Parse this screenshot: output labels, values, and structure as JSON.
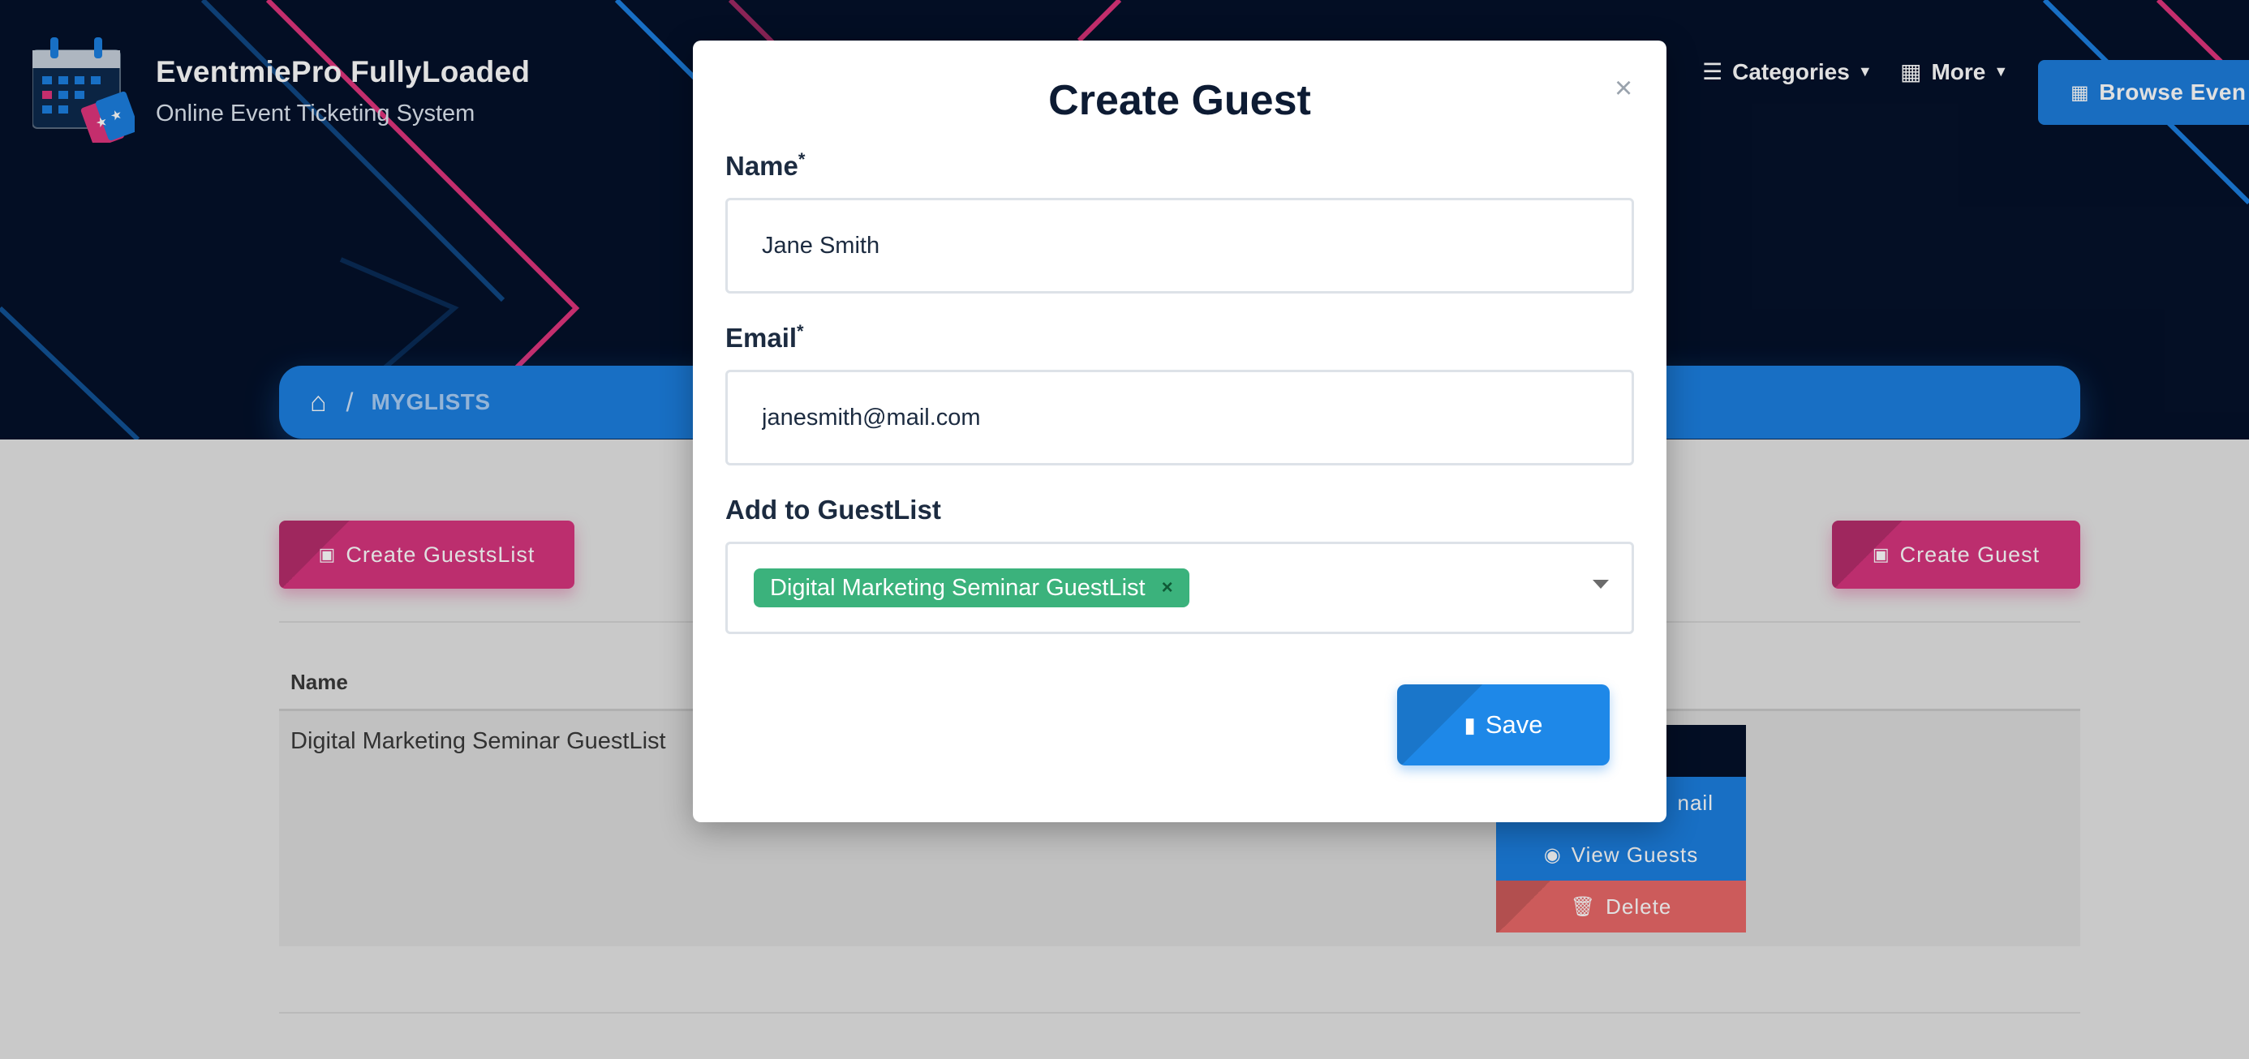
{
  "brand": {
    "title": "EventmiePro FullyLoaded",
    "subtitle": "Online Event Ticketing System"
  },
  "nav": {
    "categories": "Categories",
    "more": "More",
    "browse": "Browse Even"
  },
  "breadcrumb": {
    "current": "MYGLISTS"
  },
  "actions": {
    "create_guestslist": "Create GuestsList",
    "create_guest": "Create Guest"
  },
  "table": {
    "headers": [
      "Name"
    ],
    "rows": [
      {
        "name": "Digital Marketing Seminar GuestList"
      }
    ]
  },
  "row_menu": {
    "email": "nail",
    "view_guests": "View Guests",
    "delete": "Delete"
  },
  "modal": {
    "title": "Create Guest",
    "close": "×",
    "name_label": "Name",
    "name_value": "Jane Smith",
    "email_label": "Email",
    "email_value": "janesmith@mail.com",
    "guestlist_label": "Add to GuestList",
    "selected_guestlist": "Digital Marketing Seminar GuestList",
    "tag_remove": "×",
    "required_mark": "*",
    "save": "Save"
  },
  "colors": {
    "header_bg": "#04112a",
    "primary": "#1c7fe0",
    "pink": "#d6357e",
    "green_tag": "#3bb27c",
    "danger": "#e96868"
  }
}
